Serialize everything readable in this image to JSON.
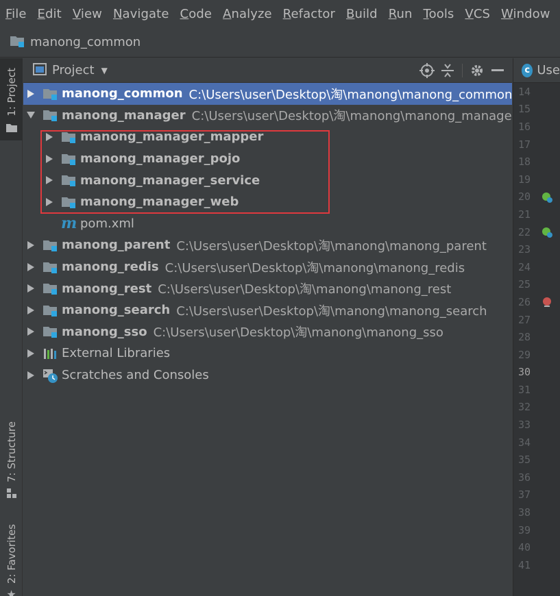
{
  "menu": [
    "File",
    "Edit",
    "View",
    "Navigate",
    "Code",
    "Analyze",
    "Refactor",
    "Build",
    "Run",
    "Tools",
    "VCS",
    "Window"
  ],
  "breadcrumb": {
    "label": "manong_common"
  },
  "side_tabs": {
    "project": "1: Project",
    "structure": "7: Structure",
    "favorites": "2: Favorites"
  },
  "panel": {
    "title": "Project"
  },
  "tree": [
    {
      "name": "manong_common",
      "path": "C:\\Users\\user\\Desktop\\淘\\manong\\manong_common",
      "expanded": false,
      "selected": true
    },
    {
      "name": "manong_manager",
      "path": "C:\\Users\\user\\Desktop\\淘\\manong\\manong_manager",
      "expanded": true,
      "selected": false
    },
    {
      "name": "manong_manager_mapper"
    },
    {
      "name": "manong_manager_pojo"
    },
    {
      "name": "manong_manager_service"
    },
    {
      "name": "manong_manager_web"
    },
    {
      "name": "pom.xml"
    },
    {
      "name": "manong_parent",
      "path": "C:\\Users\\user\\Desktop\\淘\\manong\\manong_parent"
    },
    {
      "name": "manong_redis",
      "path": "C:\\Users\\user\\Desktop\\淘\\manong\\manong_redis"
    },
    {
      "name": "manong_rest",
      "path": "C:\\Users\\user\\Desktop\\淘\\manong\\manong_rest"
    },
    {
      "name": "manong_search",
      "path": "C:\\Users\\user\\Desktop\\淘\\manong\\manong_search"
    },
    {
      "name": "manong_sso",
      "path": "C:\\Users\\user\\Desktop\\淘\\manong\\manong_sso"
    },
    {
      "name": "External Libraries"
    },
    {
      "name": "Scratches and Consoles"
    }
  ],
  "editor": {
    "tab_label": "Use",
    "tab_icon_letter": "c",
    "current_line": "30",
    "lines": [
      "14",
      "15",
      "16",
      "17",
      "18",
      "19",
      "20",
      "21",
      "22",
      "23",
      "24",
      "25",
      "26",
      "27",
      "28",
      "29",
      "30",
      "31",
      "32",
      "33",
      "34",
      "35",
      "36",
      "37",
      "38",
      "39",
      "40",
      "41"
    ]
  },
  "colors": {
    "selection": "#4b6eaf",
    "highlight_box": "#e0393e",
    "module_marker": "#2fa7e1"
  }
}
